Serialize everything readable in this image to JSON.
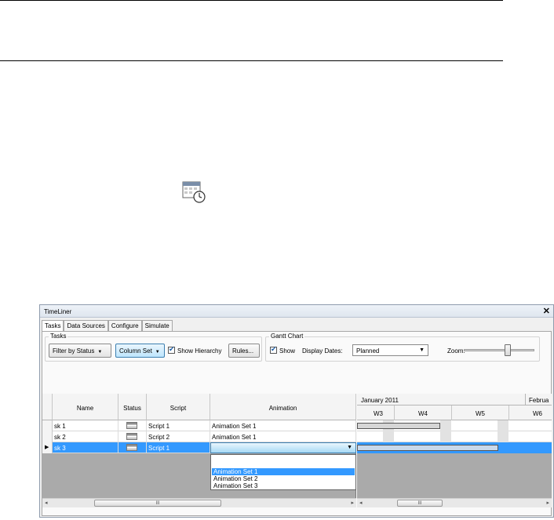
{
  "window": {
    "title": "TimeLiner",
    "close_glyph": "✕"
  },
  "tabs": [
    {
      "label": "Tasks",
      "active": true
    },
    {
      "label": "Data Sources",
      "active": false
    },
    {
      "label": "Configure",
      "active": false
    },
    {
      "label": "Simulate",
      "active": false
    }
  ],
  "tasks_group": {
    "label": "Tasks",
    "filter_button": "Filter by Status",
    "column_set_button": "Column Set",
    "show_hierarchy": {
      "label": "Show Hierarchy",
      "checked": true
    },
    "rules_button": "Rules..."
  },
  "gantt_group": {
    "label": "Gantt Chart",
    "show": {
      "label": "Show",
      "checked": true
    },
    "display_dates_label": "Display Dates:",
    "display_dates_value": "Planned",
    "zoom_label": "Zoom:",
    "zoom_level": 0.62
  },
  "grid": {
    "columns": [
      "Name",
      "Status",
      "Script",
      "Animation"
    ],
    "rows": [
      {
        "name": "sk 1",
        "script": "Script 1",
        "animation": "Animation Set 1",
        "selected": false
      },
      {
        "name": "sk 2",
        "script": "Script 2",
        "animation": "Animation Set 1",
        "selected": false
      },
      {
        "name": "sk 3",
        "script": "Script 1",
        "animation": "",
        "selected": true
      }
    ],
    "row_pointer_glyph": "▶"
  },
  "animation_dropdown": {
    "options": [
      "Animation Set 1",
      "Animation Set 2",
      "Animation Set 3"
    ],
    "highlighted": "Animation Set 1"
  },
  "gantt": {
    "month_labels": [
      "January 2011",
      "Februa"
    ],
    "weeks": [
      "W3",
      "W4",
      "W5",
      "W6"
    ]
  },
  "scrollbar": {
    "thumb_glyph": "III",
    "left_arrow": "◂",
    "right_arrow": "▸"
  },
  "colors": {
    "selection": "#3399ff",
    "grid_background": "#aaaaaa",
    "header": "#f4f4f4"
  },
  "icons": [
    "calendar-clock-icon",
    "checkmark-icon",
    "dropdown-arrow-icon",
    "close-icon"
  ]
}
